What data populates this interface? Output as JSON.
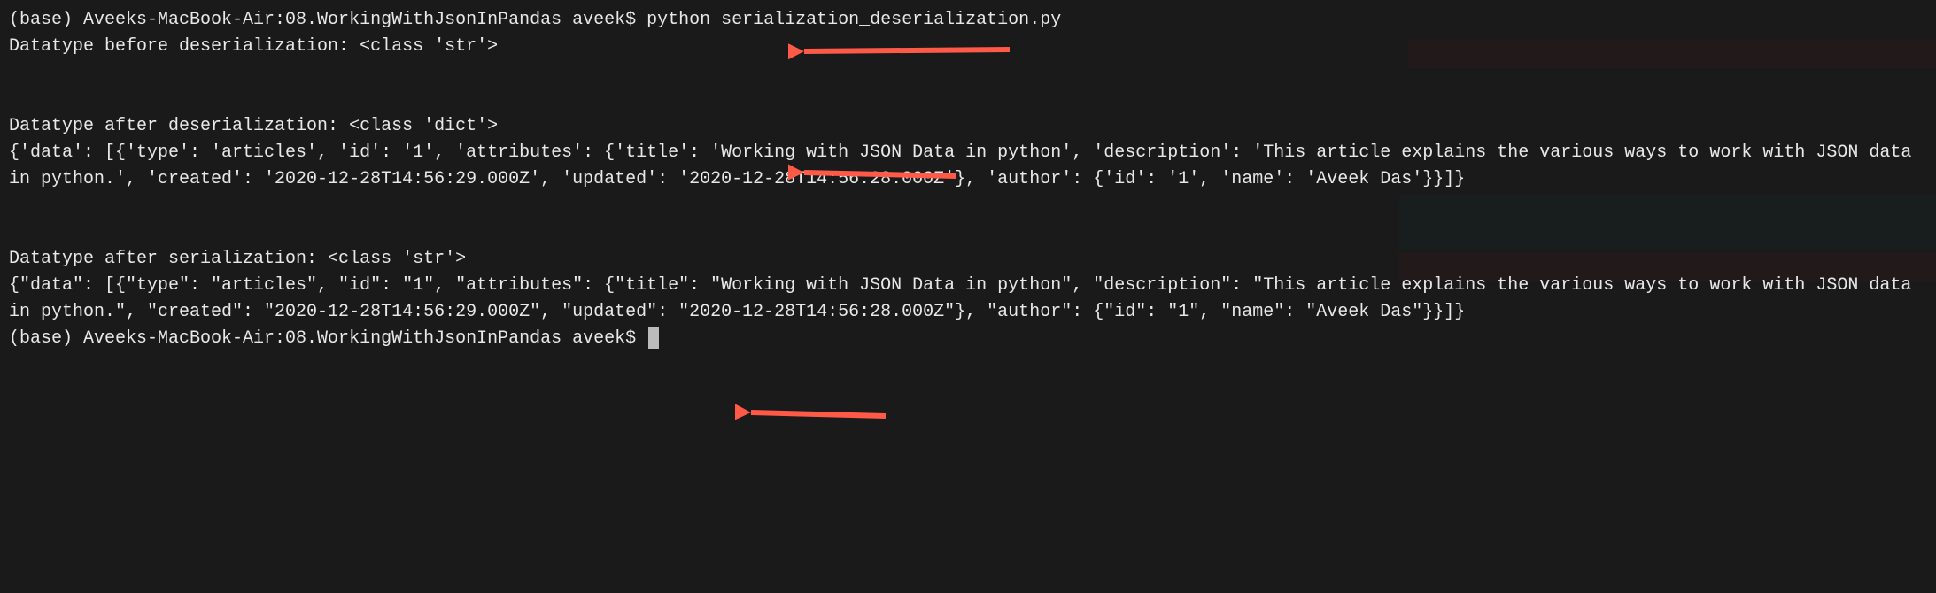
{
  "terminal": {
    "lines": {
      "prompt1": "(base) Aveeks-MacBook-Air:08.WorkingWithJsonInPandas aveek$ python serialization_deserialization.py",
      "before_deserial": "Datatype before deserialization: <class 'str'>",
      "after_deserial": "Datatype after deserialization: <class 'dict'>",
      "dict_output": "{'data': [{'type': 'articles', 'id': '1', 'attributes': {'title': 'Working with JSON Data in python', 'description': 'This article explains the various ways to work with JSON data in python.', 'created': '2020-12-28T14:56:29.000Z', 'updated': '2020-12-28T14:56:28.000Z'}, 'author': {'id': '1', 'name': 'Aveek Das'}}]}",
      "after_serial": "Datatype after serialization: <class 'str'>",
      "json_output": "{\"data\": [{\"type\": \"articles\", \"id\": \"1\", \"attributes\": {\"title\": \"Working with JSON Data in python\", \"description\": \"This article explains the various ways to work with JSON data in python.\", \"created\": \"2020-12-28T14:56:29.000Z\", \"updated\": \"2020-12-28T14:56:28.000Z\"}, \"author\": {\"id\": \"1\", \"name\": \"Aveek Das\"}}]}",
      "prompt2": "(base) Aveeks-MacBook-Air:08.WorkingWithJsonInPandas aveek$ "
    }
  },
  "annotations": {
    "arrow_color": "#ff5a47"
  }
}
